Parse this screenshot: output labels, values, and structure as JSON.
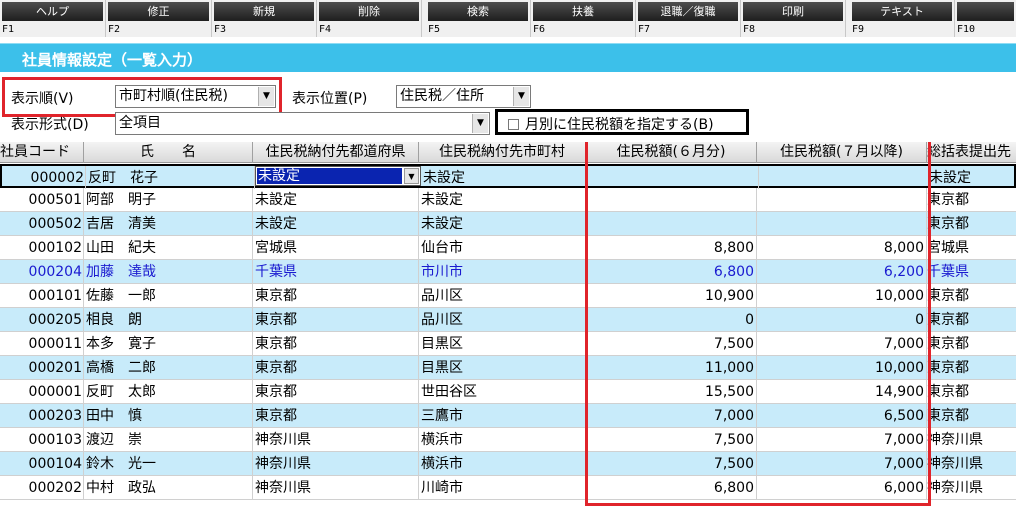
{
  "fkeys": [
    {
      "label": "ヘルプ",
      "key": "F1"
    },
    {
      "label": "修正",
      "key": "F2"
    },
    {
      "label": "新規",
      "key": "F3"
    },
    {
      "label": "削除",
      "key": "F4"
    },
    {
      "label": "検索",
      "key": "F5"
    },
    {
      "label": "扶養",
      "key": "F6"
    },
    {
      "label": "退職／復職",
      "key": "F7"
    },
    {
      "label": "印刷",
      "key": "F8"
    },
    {
      "label": "テキスト",
      "key": "F9"
    },
    {
      "label": "",
      "key": "F10"
    }
  ],
  "title": "社員情報設定（一覧入力）",
  "filters": {
    "order_label": "表示順(V)",
    "order_value": "市町村順(住民税)",
    "position_label": "表示位置(P)",
    "position_value": "住民税／住所",
    "format_label": "表示形式(D)",
    "format_value": "全項目",
    "monthly_checkbox_label": "月別に住民税額を指定する(B)",
    "monthly_checked": false
  },
  "table": {
    "headers": {
      "code": "社員コード",
      "name": "氏　　名",
      "pref": "住民税納付先都道府県",
      "city": "住民税納付先市町村",
      "june": "住民税額(６月分)",
      "july": "住民税額(７月以降)",
      "summary": "総括表提出先"
    },
    "rows": [
      {
        "code": "000002",
        "name": "反町　花子",
        "pref": "未設定",
        "city": "未設定",
        "june": "",
        "july": "",
        "summary": "未設定"
      },
      {
        "code": "000501",
        "name": "阿部　明子",
        "pref": "未設定",
        "city": "未設定",
        "june": "",
        "july": "",
        "summary": "東京都"
      },
      {
        "code": "000502",
        "name": "吉居　清美",
        "pref": "未設定",
        "city": "未設定",
        "june": "",
        "july": "",
        "summary": "東京都"
      },
      {
        "code": "000102",
        "name": "山田　紀夫",
        "pref": "宮城県",
        "city": "仙台市",
        "june": "8,800",
        "july": "8,000",
        "summary": "宮城県"
      },
      {
        "code": "000204",
        "name": "加藤　達哉",
        "pref": "千葉県",
        "city": "市川市",
        "june": "6,800",
        "july": "6,200",
        "summary": "千葉県"
      },
      {
        "code": "000101",
        "name": "佐藤　一郎",
        "pref": "東京都",
        "city": "品川区",
        "june": "10,900",
        "july": "10,000",
        "summary": "東京都"
      },
      {
        "code": "000205",
        "name": "相良　朗",
        "pref": "東京都",
        "city": "品川区",
        "june": "0",
        "july": "0",
        "summary": "東京都"
      },
      {
        "code": "000011",
        "name": "本多　寛子",
        "pref": "東京都",
        "city": "目黒区",
        "june": "7,500",
        "july": "7,000",
        "summary": "東京都"
      },
      {
        "code": "000201",
        "name": "高橋　二郎",
        "pref": "東京都",
        "city": "目黒区",
        "june": "11,000",
        "july": "10,000",
        "summary": "東京都"
      },
      {
        "code": "000001",
        "name": "反町　太郎",
        "pref": "東京都",
        "city": "世田谷区",
        "june": "15,500",
        "july": "14,900",
        "summary": "東京都"
      },
      {
        "code": "000203",
        "name": "田中　慎",
        "pref": "東京都",
        "city": "三鷹市",
        "june": "7,000",
        "july": "6,500",
        "summary": "東京都"
      },
      {
        "code": "000103",
        "name": "渡辺　崇",
        "pref": "神奈川県",
        "city": "横浜市",
        "june": "7,500",
        "july": "7,000",
        "summary": "神奈川県"
      },
      {
        "code": "000104",
        "name": "鈴木　光一",
        "pref": "神奈川県",
        "city": "横浜市",
        "june": "7,500",
        "july": "7,000",
        "summary": "神奈川県"
      },
      {
        "code": "000202",
        "name": "中村　政弘",
        "pref": "神奈川県",
        "city": "川崎市",
        "june": "6,800",
        "july": "6,000",
        "summary": "神奈川県"
      }
    ]
  },
  "colors": {
    "titlebar": "#3cc0ea",
    "highlight_box": "#e0242b",
    "alt_row": "#c8ebfa",
    "blue_row_text": "#1a1ad0"
  },
  "icons": {
    "dropdown": "chevron-down-icon",
    "checkbox": "checkbox-unchecked-icon"
  }
}
